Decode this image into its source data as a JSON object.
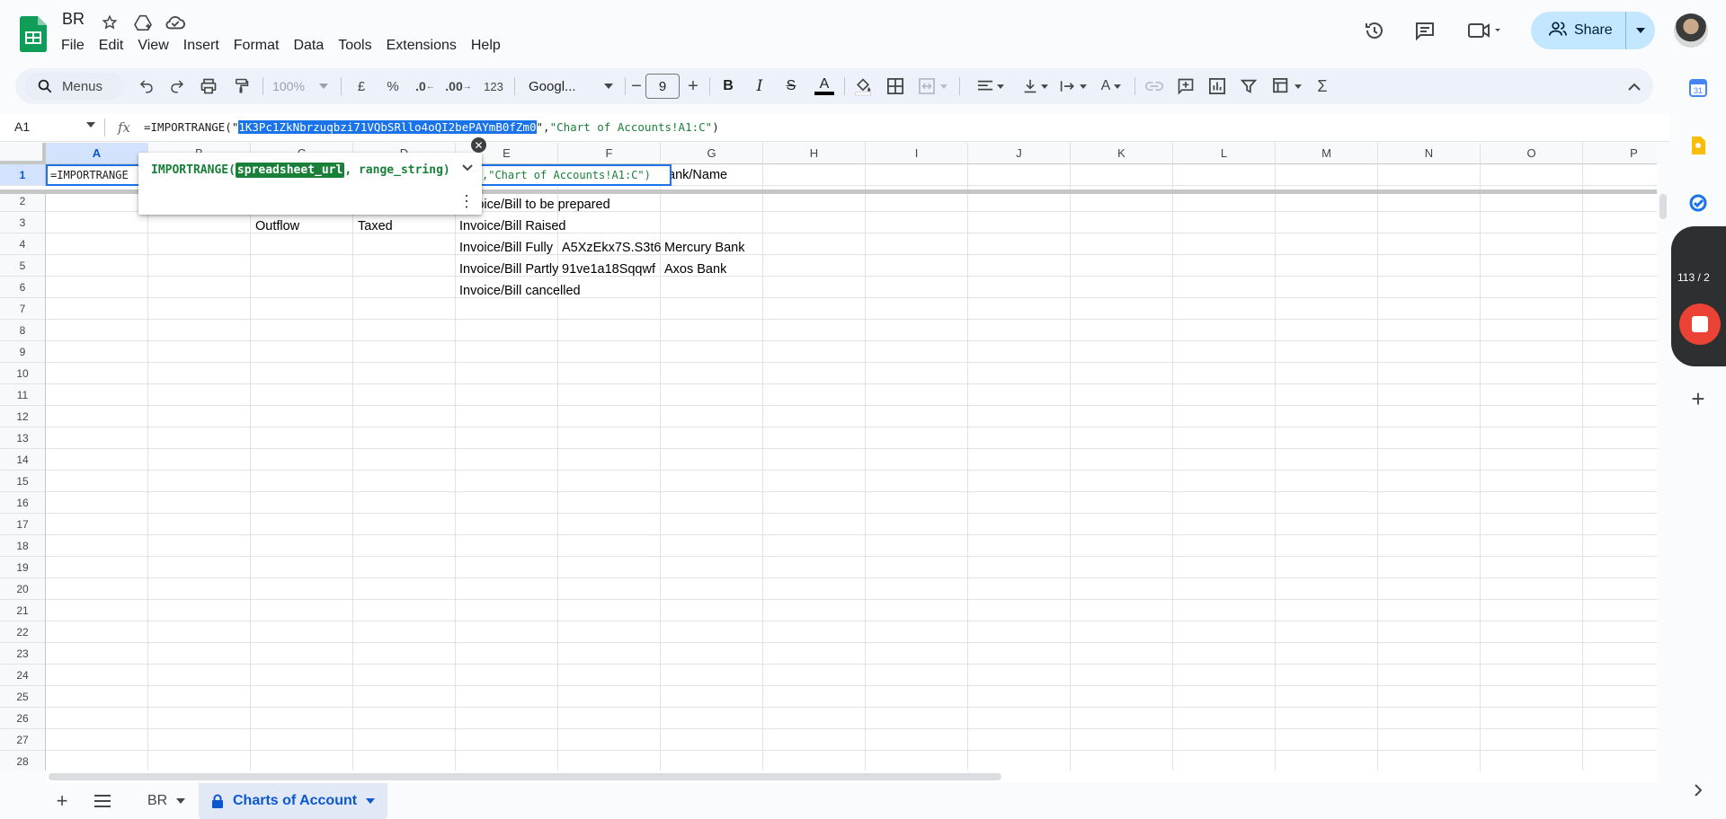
{
  "app": {
    "doc_title": "BR",
    "menu": [
      "File",
      "Edit",
      "View",
      "Insert",
      "Format",
      "Data",
      "Tools",
      "Extensions",
      "Help"
    ],
    "share_label": "Share"
  },
  "toolbar": {
    "menus_label": "Menus",
    "zoom": "100%",
    "currency": "£",
    "percent": "%",
    "decrease_decimal": ".0",
    "increase_decimal": ".00",
    "number_format": "123",
    "font_family": "Googl...",
    "font_size": "9"
  },
  "formula_bar": {
    "name_box": "A1",
    "fx": "fx",
    "prefix": "=IMPORTRANGE(\"",
    "highlight": "1K3Pc1ZkNbrzuqbzi71VQbSRllo4oQI2bePAYmB0fZm0",
    "suffix_plain": "\",",
    "suffix_str": "\"Chart of Accounts!A1:C\"",
    "close": ")"
  },
  "grid": {
    "columns": [
      "A",
      "B",
      "C",
      "D",
      "E",
      "F",
      "G",
      "H",
      "I",
      "J",
      "K",
      "L",
      "M",
      "N",
      "O",
      "P"
    ],
    "rows": [
      "1",
      "2",
      "3",
      "4",
      "5",
      "6",
      "7",
      "8",
      "9",
      "10",
      "11",
      "12",
      "13",
      "14",
      "15",
      "16",
      "17",
      "18",
      "19",
      "20",
      "21",
      "22",
      "23",
      "24",
      "25",
      "26",
      "27",
      "28"
    ],
    "cells": {
      "g1": "ank/Name",
      "e2": "Invoice/Bill to be prepared",
      "c3": "Outflow",
      "d3": "Taxed",
      "e3": "Invoice/Bill Raised",
      "e4": "Invoice/Bill Fully",
      "f4": "A5XzEkx7S.S3t6",
      "g4": "Mercury Bank",
      "e5": "Invoice/Bill Partly",
      "f5": "91ve1a18Sqqwf",
      "g5": "Axos Bank",
      "e6": "Invoice/Bill cancelled"
    },
    "active_cell_text": "=IMPORTRANGE",
    "active_cell_tail": ",\"Chart of Accounts!A1:C\")"
  },
  "tooltip": {
    "fn_name": "IMPORTRANGE(",
    "arg1": "spreadsheet_url",
    "rest": ", range_string)"
  },
  "recorder": {
    "counter": "113 / 2"
  },
  "sheets": {
    "tabs": [
      "BR",
      "Charts of Account"
    ],
    "active": "Charts of Account"
  }
}
